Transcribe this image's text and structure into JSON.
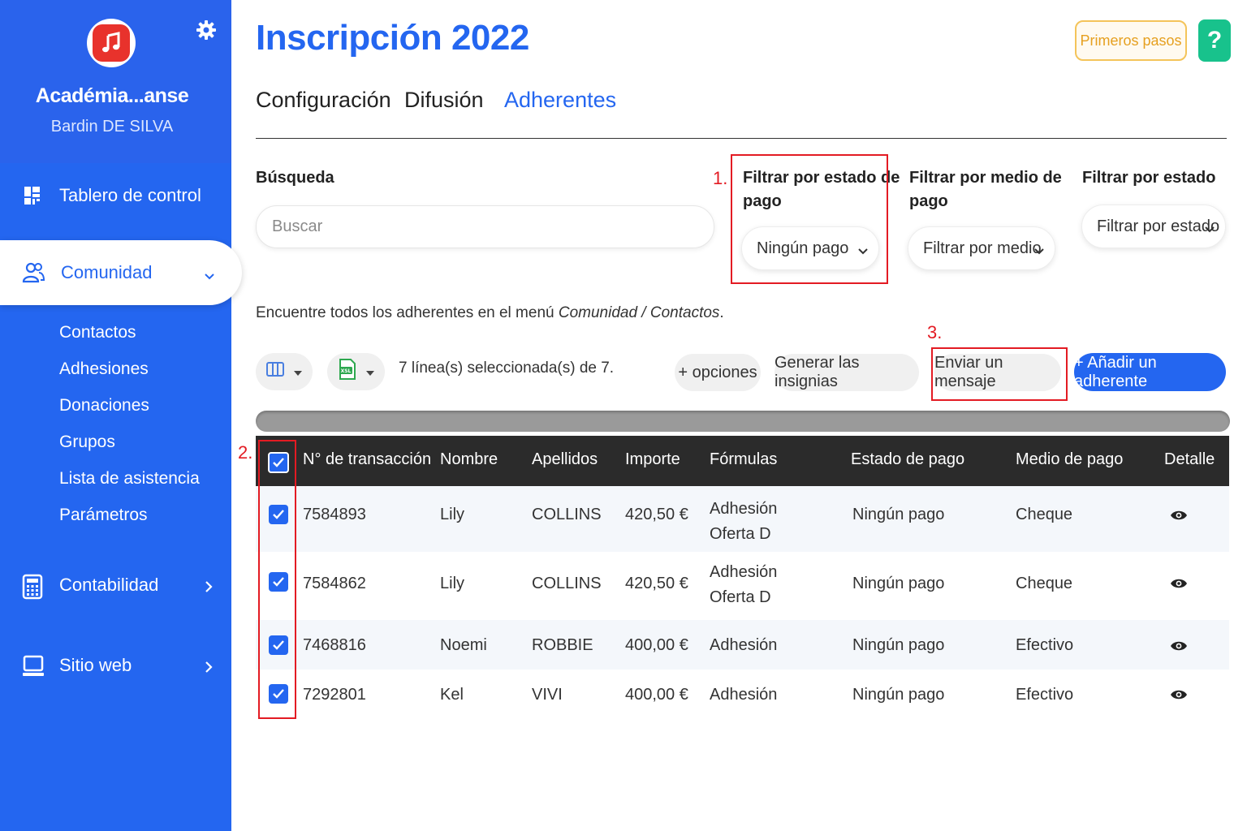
{
  "sidebar": {
    "org_name": "Académia...anse",
    "user_name": "Bardin DE SILVA",
    "nav": {
      "dashboard": "Tablero de control",
      "community": "Comunidad",
      "accounting": "Contabilidad",
      "website": "Sitio web"
    },
    "sub_items": [
      "Contactos",
      "Adhesiones",
      "Donaciones",
      "Grupos",
      "Lista de asistencia",
      "Parámetros"
    ]
  },
  "header": {
    "title": "Inscripción 2022",
    "first_steps_label": "Primeros pasos",
    "help_label": "?"
  },
  "tabs": [
    "Configuración",
    "Difusión",
    "Adherentes"
  ],
  "filters": {
    "search_label": "Búsqueda",
    "search_placeholder": "Buscar",
    "payment_status_label_1": "Filtrar por estado de",
    "payment_status_label_2": "pago",
    "payment_status_value": "Ningún pago",
    "payment_method_label_1": "Filtrar por medio de",
    "payment_method_label_2": "pago",
    "payment_method_value": "Filtrar por medio",
    "status_label": "Filtrar por estado",
    "status_value": "Filtrar por estado"
  },
  "info": {
    "prefix": "Encuentre todos los adherentes en el menú ",
    "menu_path": "Comunidad / Contactos",
    "suffix": "."
  },
  "toolbar": {
    "selection_text": "7 línea(s) seleccionada(s) de 7.",
    "more_options": "+ opciones",
    "badges": "Generar las insignias",
    "send_message": "Enviar un mensaje",
    "add_member": "+ Añadir un adherente",
    "export_icon_text": "XSL"
  },
  "annotations": [
    "1.",
    "2.",
    "3."
  ],
  "table": {
    "headers": [
      "N° de transacción",
      "Nombre",
      "Apellidos",
      "Importe",
      "Fórmulas",
      "Estado de pago",
      "Medio de pago",
      "Detalle"
    ],
    "rows": [
      {
        "id": "7584893",
        "first": "Lily",
        "last": "COLLINS",
        "amount": "420,50 €",
        "formula_1": "Adhesión",
        "formula_2": "Oferta D",
        "status": "Ningún pago",
        "method": "Cheque"
      },
      {
        "id": "7584862",
        "first": "Lily",
        "last": "COLLINS",
        "amount": "420,50 €",
        "formula_1": "Adhesión",
        "formula_2": "Oferta D",
        "status": "Ningún pago",
        "method": "Cheque"
      },
      {
        "id": "7468816",
        "first": "Noemi",
        "last": "ROBBIE",
        "amount": "400,00 €",
        "formula_1": "Adhesión",
        "formula_2": "",
        "status": "Ningún pago",
        "method": "Efectivo"
      },
      {
        "id": "7292801",
        "first": "Kel",
        "last": "VIVI",
        "amount": "400,00 €",
        "formula_1": "Adhesión",
        "formula_2": "",
        "status": "Ningún pago",
        "method": "Efectivo"
      }
    ]
  },
  "colors": {
    "brand_blue": "#2466f0",
    "highlight_red": "#e31b23",
    "help_green": "#18c28c",
    "first_steps_orange": "#e6a020"
  }
}
